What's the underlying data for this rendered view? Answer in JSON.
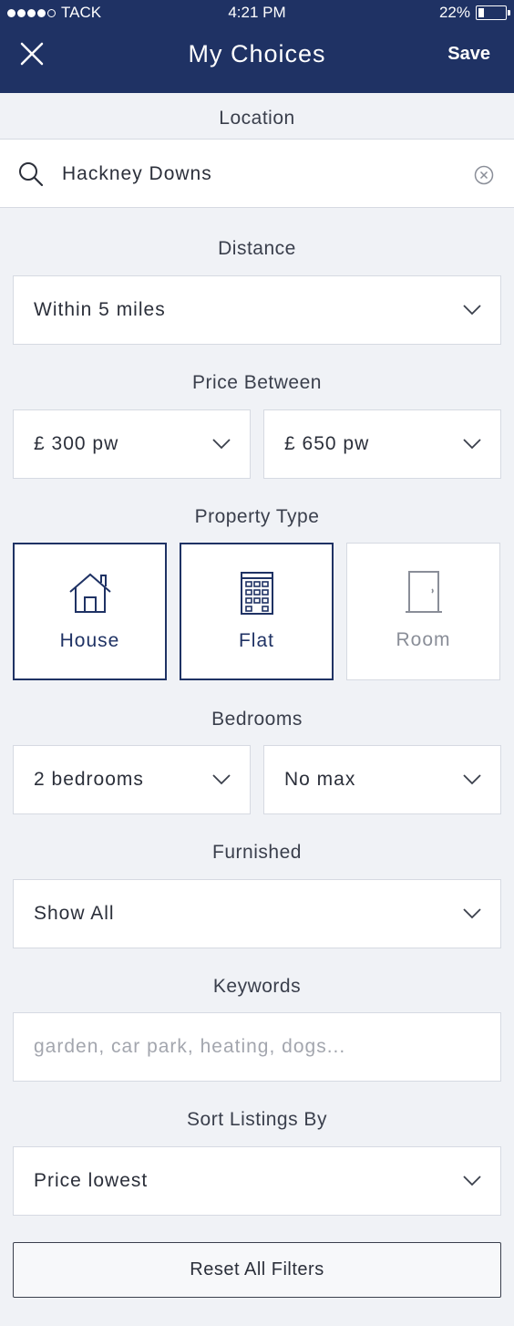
{
  "status_bar": {
    "carrier": "TACK",
    "time": "4:21 PM",
    "battery_percent": "22%",
    "battery_level": 0.22,
    "signal_bars_filled": 4,
    "signal_bars_total": 5
  },
  "header": {
    "title": "My Choices",
    "save_label": "Save",
    "close_icon": "close-icon",
    "accent_color": "#1f3264"
  },
  "location": {
    "label": "Location",
    "value": "Hackney Downs",
    "search_icon": "search-icon",
    "clear_icon": "clear-icon"
  },
  "distance": {
    "label": "Distance",
    "value": "Within 5 miles"
  },
  "price": {
    "label": "Price Between",
    "min": "£ 300 pw",
    "max": "£ 650 pw"
  },
  "property_type": {
    "label": "Property Type",
    "options": [
      {
        "label": "House",
        "icon": "house-icon",
        "selected": true
      },
      {
        "label": "Flat",
        "icon": "building-icon",
        "selected": true
      },
      {
        "label": "Room",
        "icon": "door-icon",
        "selected": false
      }
    ]
  },
  "bedrooms": {
    "label": "Bedrooms",
    "min": "2 bedrooms",
    "max": "No max"
  },
  "furnished": {
    "label": "Furnished",
    "value": "Show All"
  },
  "keywords": {
    "label": "Keywords",
    "placeholder": "garden, car park, heating, dogs..."
  },
  "sort": {
    "label": "Sort Listings By",
    "value": "Price lowest"
  },
  "reset_label": "Reset All Filters"
}
